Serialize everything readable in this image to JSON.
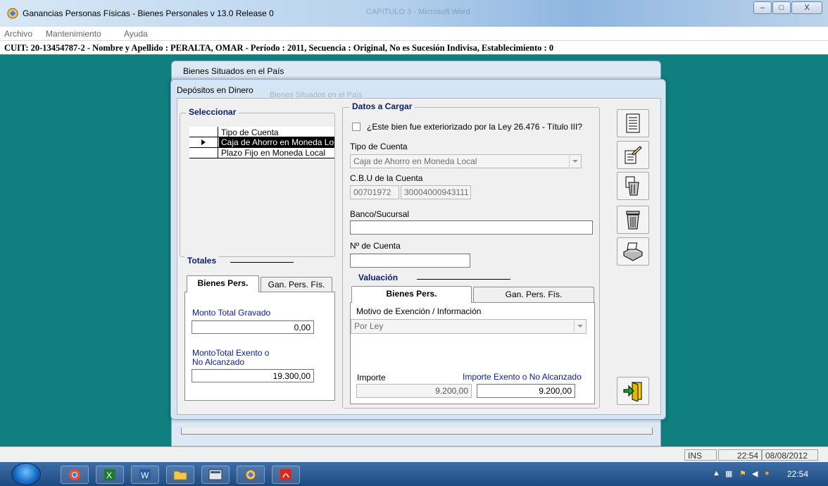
{
  "window": {
    "title": "Ganancias Personas Físicas - Bienes Personales v 13.0 Release 0",
    "background_title": "CAPITULO 3 - Microsoft Word",
    "minimize_glyph": "–",
    "maximize_glyph": "□",
    "close_glyph": "X"
  },
  "menu": {
    "items": [
      "Archivo",
      "Mantenimiento",
      "Ayuda"
    ]
  },
  "infobar": {
    "text": "CUIT: 20-13454787-2 -  Nombre y Apellido : PERALTA, OMAR -  Período : 2011,  Secuencia : Original, No es Sucesión Indivisa, Establecimiento : 0"
  },
  "parent_window": {
    "title": "Bienes Situados en el País"
  },
  "dialog": {
    "title": "Depósitos en Dinero",
    "ghost_title": "Bienes Situados en el País",
    "seleccionar": {
      "label": "Seleccionar",
      "header": "Tipo de Cuenta",
      "rows": [
        "Caja de Ahorro en Moneda Lo",
        "Plazo Fijo en Moneda Local"
      ]
    },
    "totales": {
      "label": "Totales",
      "tabs": [
        "Bienes Pers.",
        "Gan. Pers. Fís."
      ],
      "monto_total_gravado_label": "Monto Total Gravado",
      "monto_total_gravado_value": "0,00",
      "monto_exento_label_1": "MontoTotal Exento o",
      "monto_exento_label_2": "No Alcanzado",
      "monto_exento_value": "19.300,00"
    },
    "datos": {
      "label": "Datos a Cargar",
      "checkbox_label": "¿Este bien fue exteriorizado por la Ley 26.476 - Título III?",
      "checkbox_checked": false,
      "tipo_cuenta_label": "Tipo de Cuenta",
      "tipo_cuenta_value": "Caja de Ahorro en Moneda Local",
      "cbu_label": "C.B.U de la Cuenta",
      "cbu_part1": "00701972",
      "cbu_part2": "30004000943111",
      "banco_label": "Banco/Sucursal",
      "banco_value": "",
      "nro_cuenta_label": "Nº de Cuenta",
      "nro_cuenta_value": ""
    },
    "valuacion": {
      "label": "Valuación",
      "tabs": [
        "Bienes Pers.",
        "Gan. Pers. Fís."
      ],
      "motivo_label": "Motivo de Exención / Información",
      "motivo_value": "Por Ley",
      "importe_label": "Importe",
      "importe_value": "9.200,00",
      "importe_exento_label": "Importe Exento o No Alcanzado",
      "importe_exento_value": "9.200,00"
    }
  },
  "toolbar_icons": [
    "document-icon",
    "edit-icon",
    "delete-icon",
    "trash-icon",
    "print-icon",
    "exit-icon"
  ],
  "statusbar": {
    "mode": "INS",
    "time": "22:54",
    "date": "08/08/2012"
  },
  "taskbar": {
    "apps": [
      "chrome-icon",
      "excel-icon",
      "word-icon",
      "folder-icon",
      "afip-icon",
      "app-icon",
      "pdf-icon"
    ],
    "clock": "22:54"
  },
  "colors": {
    "desktop": "#0f7f7f",
    "label_blue": "#0b1c9e",
    "group_label": "#0b1c6e"
  }
}
